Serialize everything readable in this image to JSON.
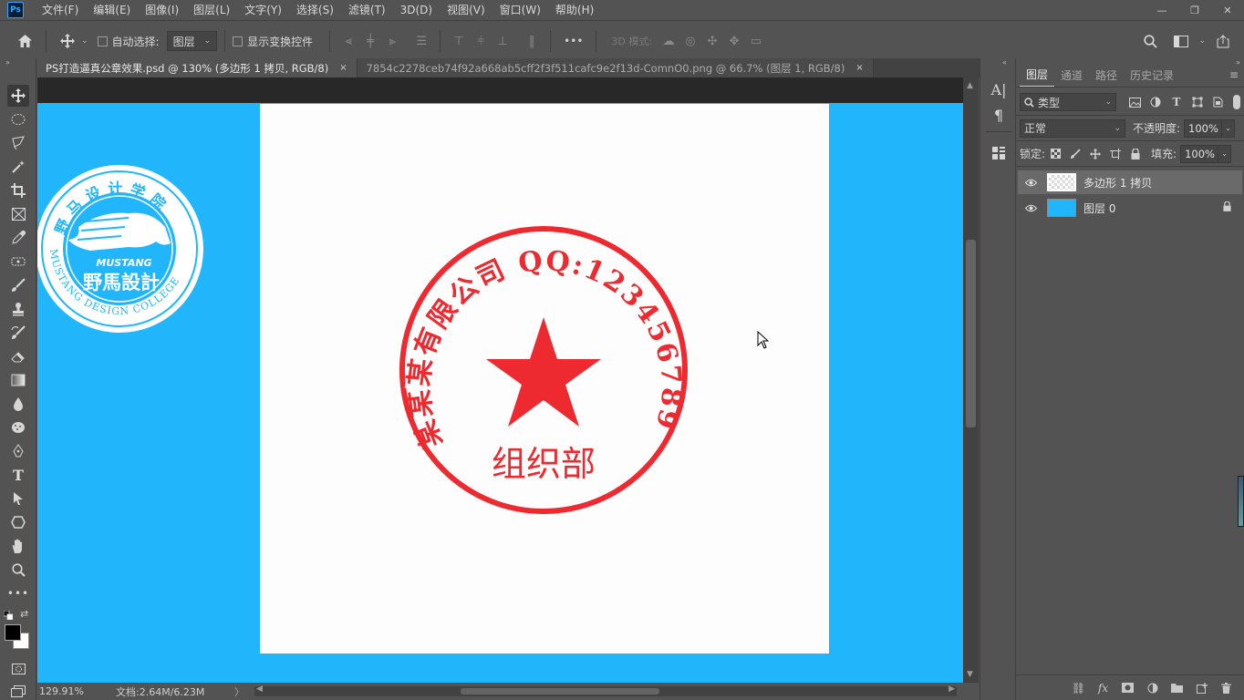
{
  "app": {
    "logo": "Ps",
    "menu": [
      "文件(F)",
      "编辑(E)",
      "图像(I)",
      "图层(L)",
      "文字(Y)",
      "选择(S)",
      "滤镜(T)",
      "3D(D)",
      "视图(V)",
      "窗口(W)",
      "帮助(H)"
    ],
    "window_controls": {
      "minimize": "—",
      "restore": "❐",
      "close": "✕"
    }
  },
  "options": {
    "auto_select_label": "自动选择:",
    "auto_select_value": "图层",
    "show_transform_label": "显示变换控件",
    "more": "•••",
    "mode_3d_label": "3D 模式:"
  },
  "tabs": [
    {
      "label": "PS打造逼真公章效果.psd @ 130% (多边形 1 拷贝, RGB/8)",
      "close": "×",
      "active": true
    },
    {
      "label": "7854c2278ceb74f92a668ab5cff2f3f511cafc9e2f13d-ComnO0.png @ 66.7% (图层 1, RGB/8)",
      "close": "×",
      "active": false
    }
  ],
  "status": {
    "zoom": "129.91%",
    "doc_size": "文档:2.64M/6.23M",
    "chevron": "〉"
  },
  "canvas": {
    "bg_color": "#21b6fc",
    "logo": {
      "top_text": "野马设计学院",
      "brand_en": "MUSTANG",
      "brand_cn": "野馬設計",
      "bottom_text": "MUSTANG DESIGN COLLEGE"
    },
    "seal": {
      "color": "#ee2a31",
      "arc_text": "某某某有限公司 QQ:123456789",
      "department": "组织部"
    }
  },
  "layers_panel": {
    "tabs": [
      "图层",
      "通道",
      "路径",
      "历史记录"
    ],
    "active_tab": "图层",
    "filter_kind": "类型",
    "blend_mode": "正常",
    "opacity_label": "不透明度:",
    "opacity_value": "100%",
    "lock_label": "锁定:",
    "fill_label": "填充:",
    "fill_value": "100%",
    "layers": [
      {
        "name": "多边形 1 拷贝",
        "selected": true,
        "locked": false
      },
      {
        "name": "图层 0",
        "selected": false,
        "locked": true
      }
    ]
  }
}
